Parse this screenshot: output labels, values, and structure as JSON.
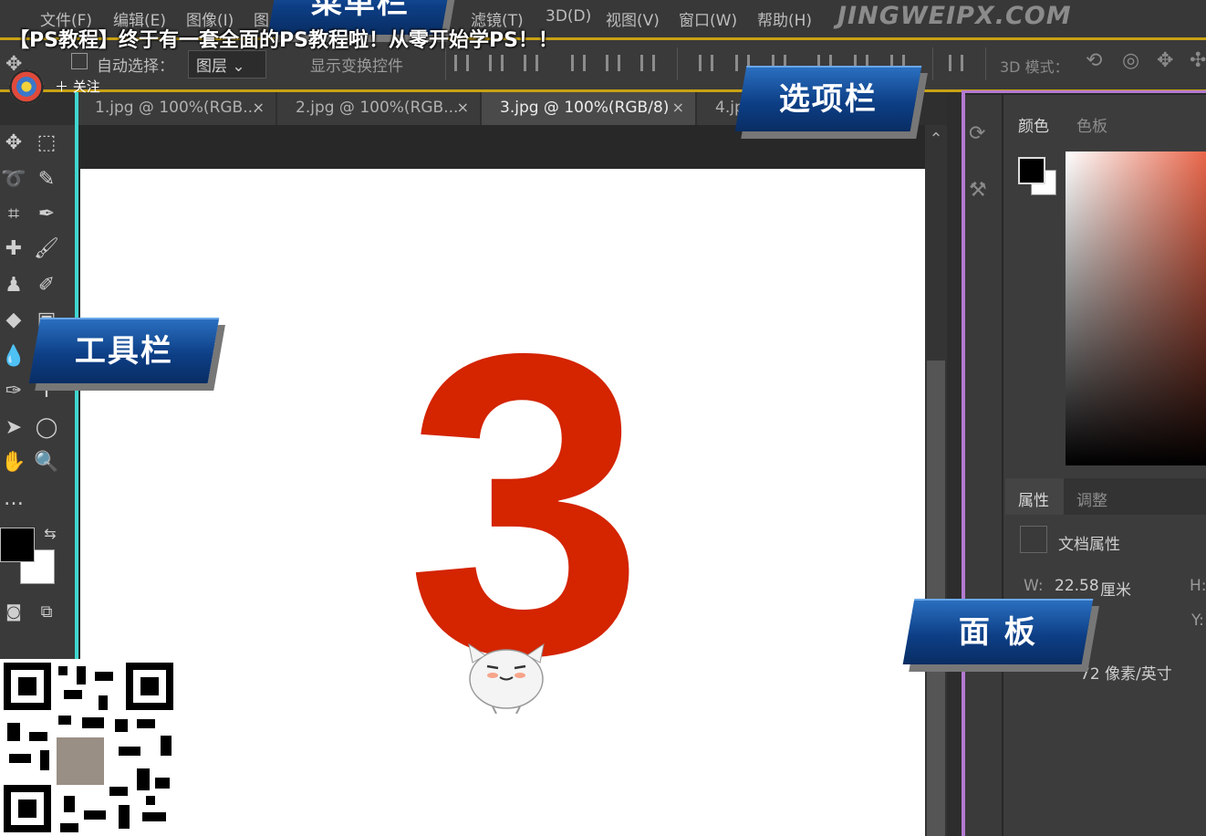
{
  "video_title": "【PS教程】终于有一套全面的PS教程啦！从零开始学PS！！",
  "watermark": "JINGWEIPX.COM",
  "menubar": {
    "items": [
      "文件(F)",
      "编辑(E)",
      "图像(I)",
      "图",
      "滤镜(T)",
      "3D(D)",
      "视图(V)",
      "窗口(W)",
      "帮助(H)"
    ]
  },
  "options_bar": {
    "auto_select_label": "自动选择：",
    "auto_select_value": "图层",
    "show_transform_label": "显示变换控件",
    "mode_3d_label": "3D 模式："
  },
  "tabs": [
    {
      "label": "1.jpg @ 100%(RGB...",
      "close": "×"
    },
    {
      "label": "2.jpg @ 100%(RGB...",
      "close": "×"
    },
    {
      "label": "3.jpg @ 100%(RGB/8)",
      "close": "×"
    },
    {
      "label": "4.jp",
      "close": ""
    }
  ],
  "canvas": {
    "number": "3",
    "number_color": "#d42400"
  },
  "panels": {
    "color_tab": "颜色",
    "swatches_tab": "色板",
    "properties_tab": "属性",
    "adjustments_tab": "调整",
    "doc_properties": "文档属性",
    "width_label": "W:",
    "width_value": "22.58",
    "width_unit": "厘米",
    "h_label": "H:",
    "y_label": "Y:",
    "resolution": "72 像素/英寸"
  },
  "callouts": {
    "menubar": "菜单栏",
    "options": "选项栏",
    "toolbar": "工具栏",
    "panel": "面 板"
  },
  "overlay": {
    "follow": "＋ 关注"
  },
  "colors": {
    "accent_gold": "#c9a214",
    "accent_cyan": "#3fd7d0",
    "accent_purple": "#b37ad1",
    "callout_blue": "#0d3f86"
  }
}
